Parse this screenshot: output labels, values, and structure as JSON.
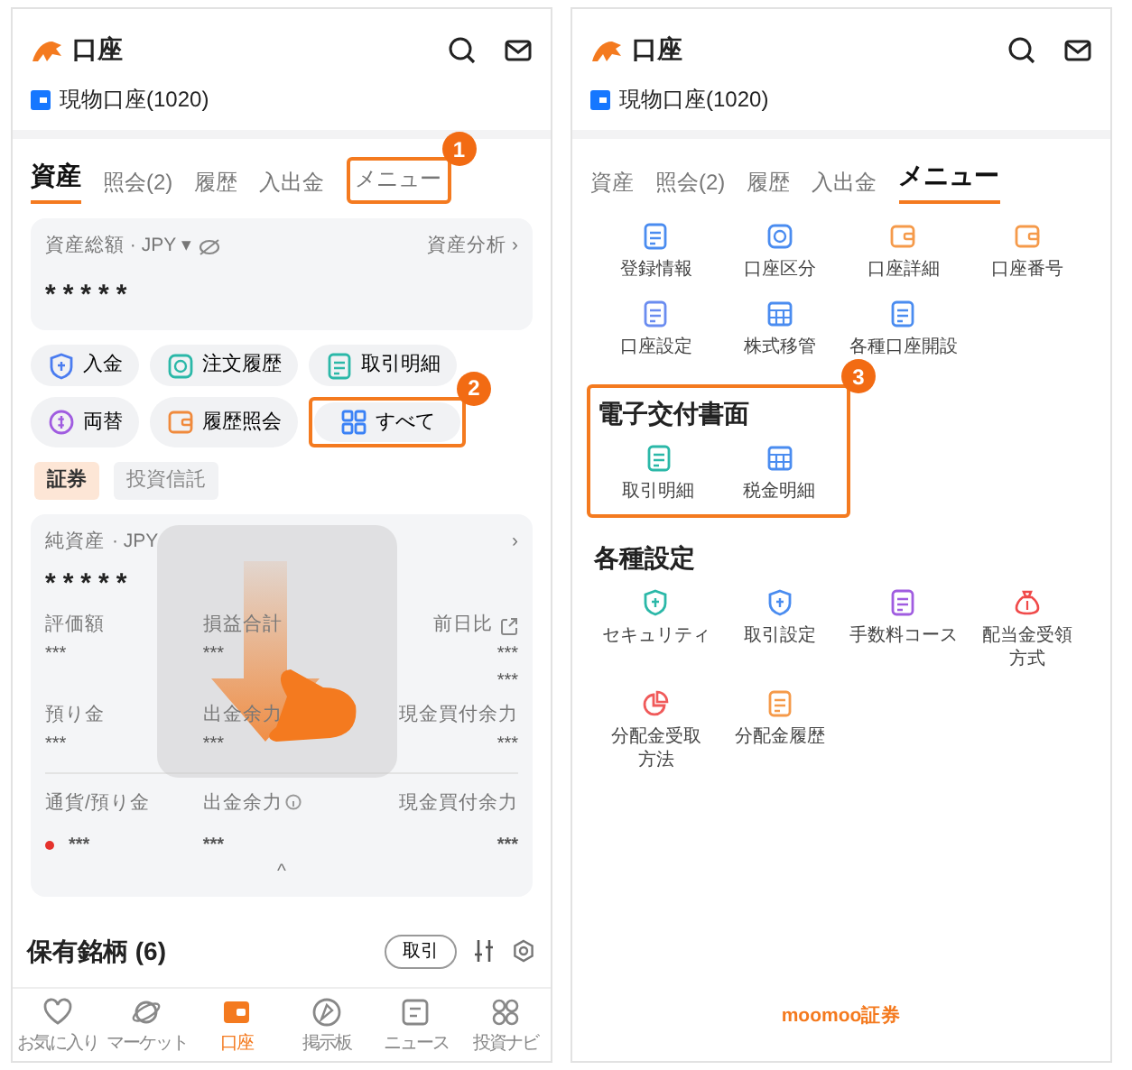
{
  "left_screen": {
    "header": {
      "title": "口座"
    },
    "account": {
      "label": "現物口座(1020)"
    },
    "tabs": [
      {
        "label": "資産",
        "selected": true
      },
      {
        "label": "照会(2)",
        "selected": false
      },
      {
        "label": "履歴",
        "selected": false
      },
      {
        "label": "入出金",
        "selected": false
      },
      {
        "label": "メニュー",
        "selected": false,
        "step": "1"
      }
    ],
    "summary": {
      "title": "資産総額 · JPY ▾",
      "link": "資産分析 ›",
      "value": "*****"
    },
    "quick_actions": [
      {
        "label": "入金",
        "color": "#4a7cf0"
      },
      {
        "label": "注文履歴",
        "color": "#2bb8a8"
      },
      {
        "label": "取引明細",
        "color": "#2bb8a8"
      },
      {
        "label": "両替",
        "color": "#a05ce0"
      },
      {
        "label": "履歴照会",
        "color": "#f08a3c"
      },
      {
        "label": "すべて",
        "color": "#3b82f6",
        "step": "2"
      }
    ],
    "segments": [
      {
        "label": "証券",
        "selected": true
      },
      {
        "label": "投資信託",
        "selected": false
      }
    ],
    "net_assets": {
      "title": "純資産",
      "currency": "· JPY",
      "arrow": "›",
      "value": "*****",
      "metrics": [
        {
          "label": "評価額",
          "value": "***"
        },
        {
          "label": "損益合計",
          "value": "***"
        },
        {
          "label": "前日比",
          "value": "***",
          "value_2": "***"
        },
        {
          "label": "預り金",
          "value": "***"
        },
        {
          "label": "出金余力",
          "value": "***"
        },
        {
          "label": "現金買付余力",
          "value": "***"
        }
      ],
      "currency_table": {
        "columns": [
          "通貨/預り金",
          "出金余力",
          "現金買付余力"
        ],
        "rows": [
          [
            "***",
            "***",
            "***"
          ]
        ]
      },
      "collapse": "^"
    },
    "holdings": {
      "title": "保有銘柄 (6)",
      "button": "取引"
    },
    "bottom_nav": [
      {
        "label": "お気に入り",
        "selected": false
      },
      {
        "label": "マーケット",
        "selected": false
      },
      {
        "label": "口座",
        "selected": true
      },
      {
        "label": "掲示板",
        "selected": false
      },
      {
        "label": "ニュース",
        "selected": false
      },
      {
        "label": "投資ナビ",
        "selected": false
      }
    ]
  },
  "right_screen": {
    "header": {
      "title": "口座"
    },
    "account": {
      "label": "現物口座(1020)"
    },
    "tabs": [
      {
        "label": "資産",
        "selected": false
      },
      {
        "label": "照会(2)",
        "selected": false
      },
      {
        "label": "履歴",
        "selected": false
      },
      {
        "label": "入出金",
        "selected": false
      },
      {
        "label": "メニュー",
        "selected": true
      }
    ],
    "menu": [
      {
        "label": "登録情報",
        "color": "#4a8cf0"
      },
      {
        "label": "口座区分",
        "color": "#4a8cf0"
      },
      {
        "label": "口座詳細",
        "color": "#f59a4a"
      },
      {
        "label": "口座番号",
        "color": "#f59a4a"
      },
      {
        "label": "口座設定",
        "color": "#6a8cf0"
      },
      {
        "label": "株式移管",
        "color": "#4a8cf0"
      },
      {
        "label": "各種口座開設",
        "color": "#4a8cf0"
      }
    ],
    "sections": [
      {
        "title": "電子交付書面",
        "step": "3",
        "items": [
          {
            "label": "取引明細",
            "color": "#2bb8a8"
          },
          {
            "label": "税金明細",
            "color": "#4a8cf0"
          }
        ]
      },
      {
        "title": "各種設定",
        "items": [
          {
            "label": "セキュリティ",
            "color": "#2bb8a8"
          },
          {
            "label": "取引設定",
            "color": "#4a8cf0"
          },
          {
            "label": "手数料コース",
            "color": "#a05ce0"
          },
          {
            "label": "配当金受領方式",
            "color": "#f04a4a"
          },
          {
            "label": "分配金受取方法",
            "color": "#f05a5a"
          },
          {
            "label": "分配金履歴",
            "color": "#f59a4a"
          }
        ]
      }
    ],
    "footer": "moomoo証券"
  }
}
